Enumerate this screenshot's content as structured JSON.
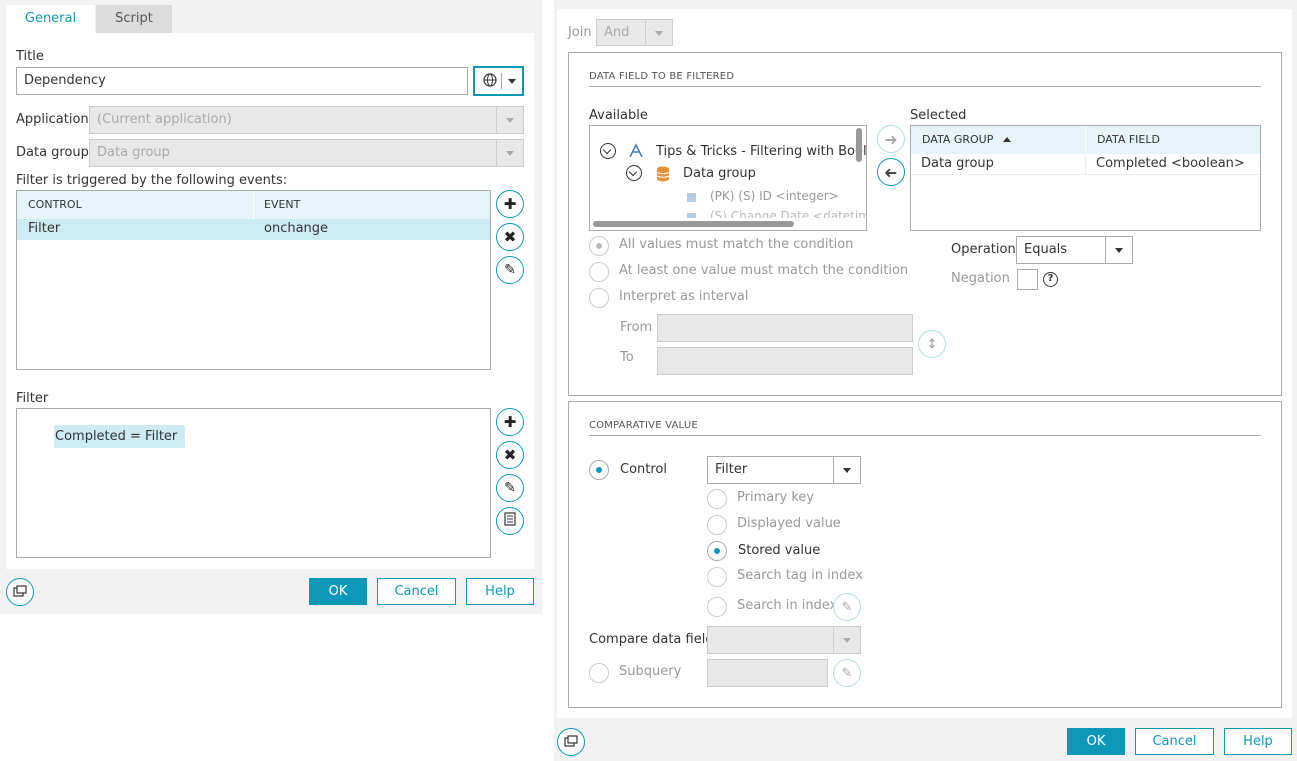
{
  "left_dialog": {
    "tabs": [
      {
        "label": "General",
        "active": true
      },
      {
        "label": "Script",
        "active": false
      }
    ],
    "title_label": "Title",
    "title_value": "Dependency",
    "application_label": "Application",
    "application_value": "(Current application)",
    "data_group_label": "Data group",
    "data_group_placeholder": "Data group",
    "events_label": "Filter is triggered by the following events:",
    "events_columns": [
      "CONTROL",
      "EVENT"
    ],
    "events_rows": [
      {
        "control": "Filter",
        "event": "onchange"
      }
    ],
    "filter_label": "Filter",
    "filter_expression": "Completed = Filter",
    "buttons": {
      "ok": "OK",
      "cancel": "Cancel",
      "help": "Help"
    }
  },
  "right_dialog": {
    "join_label": "Join",
    "join_value": "And",
    "data_field_section": {
      "title": "DATA FIELD TO BE FILTERED",
      "available_label": "Available",
      "tree": [
        {
          "label": "Tips & Tricks - Filtering with Booleans",
          "icon": "app-icon"
        },
        {
          "label": "Data group",
          "icon": "database-icon"
        },
        {
          "label": "(PK) (S) ID <integer>",
          "icon": "field-icon"
        },
        {
          "label": "(S) Change Date <datetime>",
          "icon": "field-icon"
        }
      ],
      "selected_label": "Selected",
      "selected_columns": [
        "DATA GROUP",
        "DATA FIELD"
      ],
      "selected_rows": [
        {
          "group": "Data group",
          "field": "Completed <boolean>"
        }
      ],
      "match_options": [
        {
          "label": "All values must match the condition",
          "selected": true
        },
        {
          "label": "At least one value must match the condition",
          "selected": false
        },
        {
          "label": "Interpret as interval",
          "selected": false
        }
      ],
      "from_label": "From",
      "to_label": "To",
      "operation_label": "Operation",
      "operation_value": "Equals",
      "negation_label": "Negation"
    },
    "comparative_section": {
      "title": "COMPARATIVE VALUE",
      "control_label": "Control",
      "control_value": "Filter",
      "value_options": [
        {
          "label": "Primary key",
          "selected": false
        },
        {
          "label": "Displayed value",
          "selected": false
        },
        {
          "label": "Stored value",
          "selected": true
        },
        {
          "label": "Search tag in index",
          "selected": false
        },
        {
          "label": "Search in index",
          "selected": false
        }
      ],
      "compare_label": "Compare data field",
      "subquery_label": "Subquery"
    },
    "buttons": {
      "ok": "OK",
      "cancel": "Cancel",
      "help": "Help"
    }
  },
  "colors": {
    "accent": "#0d98ba",
    "header_bg": "#e4f4f9",
    "selected_row": "#cdebf3"
  }
}
